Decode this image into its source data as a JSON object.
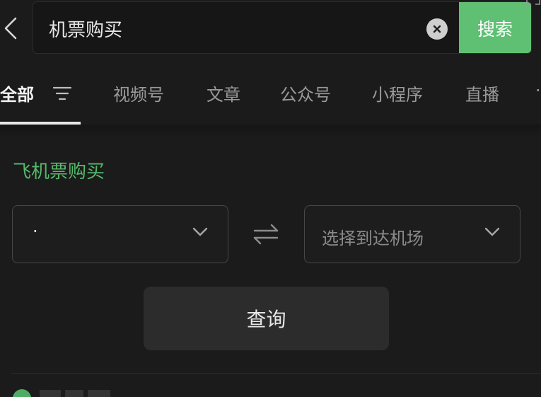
{
  "search": {
    "query": "机票购买",
    "button_label": "搜索"
  },
  "tabs": [
    {
      "label": "全部",
      "active": true
    },
    {
      "label": "视频号"
    },
    {
      "label": "文章"
    },
    {
      "label": "公众号"
    },
    {
      "label": "小程序"
    },
    {
      "label": "直播"
    }
  ],
  "card": {
    "title": "飞机票购买",
    "from_value": "·",
    "to_placeholder": "选择到达机场",
    "query_label": "查询"
  },
  "colors": {
    "accent": "#5fbf73",
    "title_green": "#55b86b",
    "background": "#1b1b1b"
  },
  "icons": {
    "back": "chevron-left-icon",
    "clear": "clear-icon",
    "filter": "filter-icon",
    "dropdown": "chevron-down-icon",
    "swap": "swap-icon"
  }
}
